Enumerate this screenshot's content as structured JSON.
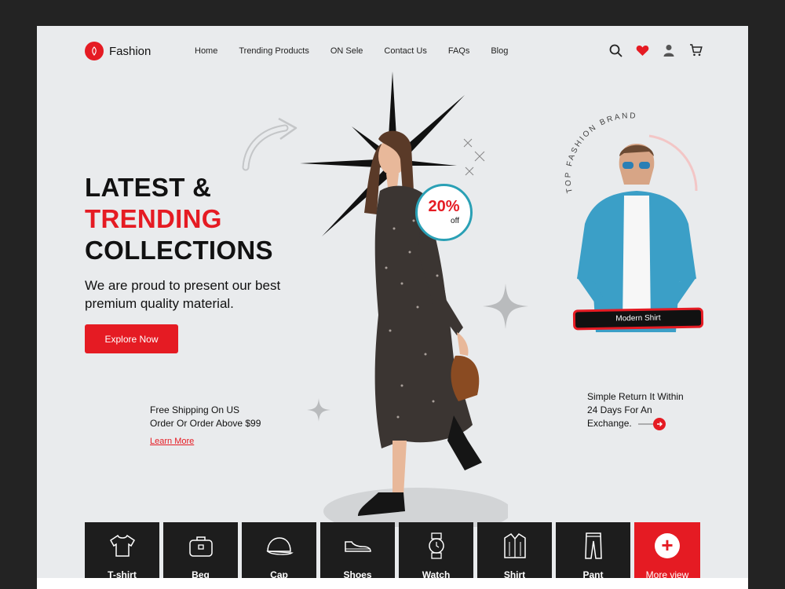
{
  "brand": {
    "name": "Fashion",
    "accent": "#e51b23"
  },
  "nav": {
    "items": [
      "Home",
      "Trending Products",
      "ON Sele",
      "Contact Us",
      "FAQs",
      "Blog"
    ],
    "icons": [
      "search-icon",
      "heart-icon",
      "user-icon",
      "cart-icon"
    ]
  },
  "hero": {
    "title_line1": "LATEST &",
    "title_line2": "TRENDING",
    "title_line3": "COLLECTIONS",
    "subtitle": "We are proud to present our best premium quality material.",
    "cta": "Explore Now"
  },
  "discount": {
    "value": "20%",
    "suffix": "off"
  },
  "promo": {
    "brand_ring_text": "TOP FASHION BRAND",
    "product_label": "Modern Shirt"
  },
  "shipping": {
    "text_line1": "Free Shipping On US",
    "text_line2": "Order Or Order Above $99",
    "link": "Learn More"
  },
  "returns": {
    "text_line1": "Simple Return It Within",
    "text_line2": "24 Days For An",
    "text_line3": "Exchange."
  },
  "categories": [
    {
      "label": "T-shirt",
      "icon": "tshirt-icon"
    },
    {
      "label": "Beg",
      "icon": "bag-icon"
    },
    {
      "label": "Cap",
      "icon": "cap-icon"
    },
    {
      "label": "Shoes",
      "icon": "shoe-icon"
    },
    {
      "label": "Watch",
      "icon": "watch-icon"
    },
    {
      "label": "Shirt",
      "icon": "shirt-icon"
    },
    {
      "label": "Pant",
      "icon": "pant-icon"
    }
  ],
  "more_view": "More view"
}
